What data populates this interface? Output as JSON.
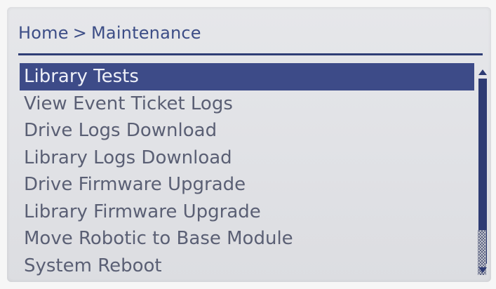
{
  "breadcrumb": {
    "home": "Home",
    "separator": ">",
    "current": "Maintenance"
  },
  "menu": {
    "selected_index": 0,
    "items": [
      {
        "label": "Library Tests"
      },
      {
        "label": "View Event Ticket Logs"
      },
      {
        "label": "Drive Logs Download"
      },
      {
        "label": "Library Logs Download"
      },
      {
        "label": "Drive Firmware Upgrade"
      },
      {
        "label": "Library Firmware Upgrade"
      },
      {
        "label": "Move Robotic to Base Module"
      },
      {
        "label": "System Reboot"
      }
    ]
  },
  "scrollbar": {
    "up_icon": "scroll-up-arrow-icon",
    "down_icon": "scroll-down-arrow-icon",
    "position_fraction": 1.0
  },
  "colors": {
    "screen_bg": "#e1e2e6",
    "text": "#5a5f74",
    "accent": "#3d4b88",
    "highlight_text": "#eef0f8"
  }
}
